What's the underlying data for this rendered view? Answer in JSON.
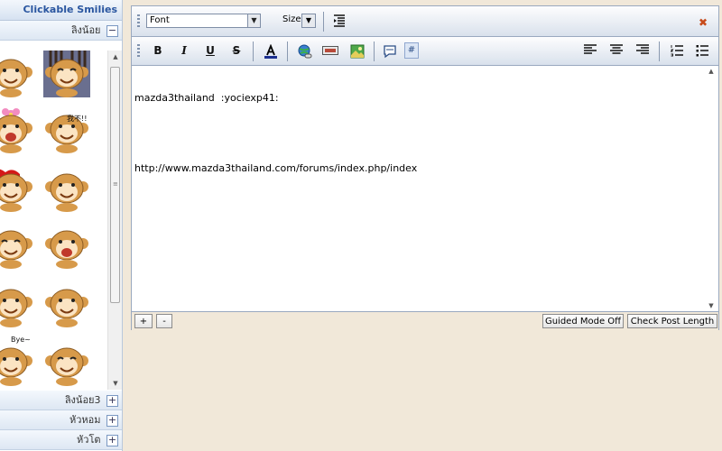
{
  "smilies_panel": {
    "title": "Clickable Smilies",
    "categories": [
      {
        "label": "ลิงน้อย",
        "toggle": "−"
      },
      {
        "label": "ลิงน้อย3",
        "toggle": "+"
      },
      {
        "label": "หัวหอม",
        "toggle": "+"
      },
      {
        "label": "หัวโต",
        "toggle": "+"
      }
    ],
    "smiley_captions": [
      "我不!!",
      "Bye~"
    ]
  },
  "toolbar": {
    "font_select": "Font",
    "size_select": "Size",
    "bold": "B",
    "italic": "I",
    "underline": "U",
    "strike": "S"
  },
  "editor": {
    "lines": [
      "mazda3thailand  :yociexp41:",
      "",
      "http://www.mazda3thailand.com/forums/index.php/index"
    ]
  },
  "bottom_bar": {
    "plus": "+",
    "minus": "-",
    "guided_mode": "Guided Mode Off",
    "check_length": "Check Post Length"
  },
  "colors": {
    "panel_title": "#2a56a0",
    "page_bg": "#f1e8d9",
    "close_x": "#c74b1b",
    "monkey": "#d79a4a"
  }
}
